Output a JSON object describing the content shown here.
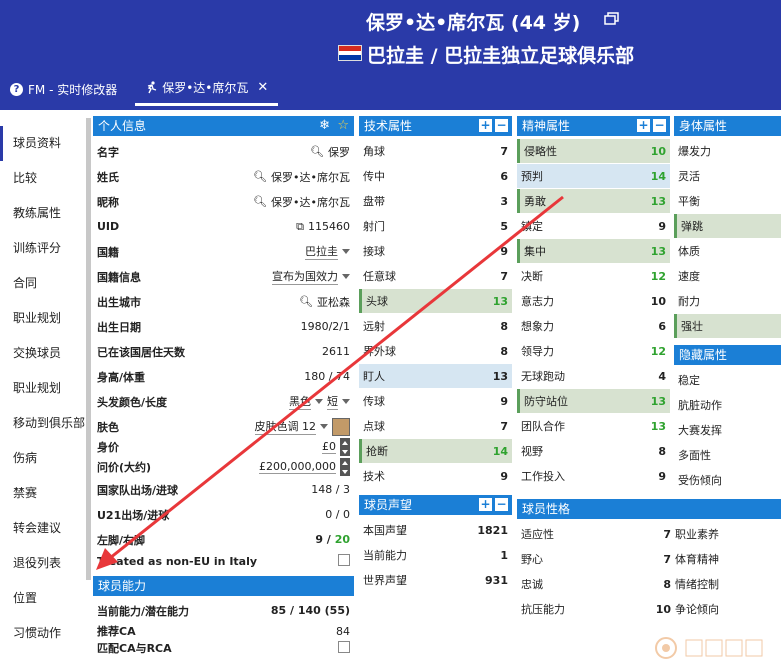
{
  "header": {
    "player_title": "保罗•达•席尔瓦 (44 岁)",
    "club": "巴拉圭 / 巴拉圭独立足球俱乐部",
    "flag_colors": [
      "#d52b1e",
      "#ffffff",
      "#0038a8"
    ],
    "background": "#2a3aa8"
  },
  "tabs": [
    {
      "label": "FM - 实时修改器",
      "icon": "question-icon"
    },
    {
      "label": "保罗•达•席尔瓦",
      "icon": "running-person-icon",
      "active": true
    }
  ],
  "sidebar": {
    "items": [
      "球员资料",
      "比较",
      "教练属性",
      "训练评分",
      "合同",
      "职业规划",
      "交换球员",
      "职业规划",
      "移动到俱乐部",
      "伤病",
      "禁赛",
      "转会建议",
      "退役列表",
      "位置",
      "习惯动作"
    ]
  },
  "personal": {
    "title": "个人信息",
    "rows": {
      "name": {
        "label": "名字",
        "value": "保罗"
      },
      "surname": {
        "label": "姓氏",
        "value": "保罗•达•席尔瓦"
      },
      "nickname": {
        "label": "昵称",
        "value": "保罗•达•席尔瓦"
      },
      "uid": {
        "label": "UID",
        "value": "115460"
      },
      "nationality": {
        "label": "国籍",
        "value": "巴拉圭"
      },
      "nation_info": {
        "label": "国籍信息",
        "value": "宣布为国效力"
      },
      "birth_city": {
        "label": "出生城市",
        "value": "亚松森"
      },
      "birth_date": {
        "label": "出生日期",
        "value": "1980/2/1"
      },
      "days_in_nation": {
        "label": "已在该国居住天数",
        "value": "2611"
      },
      "height_weight": {
        "label": "身高/体重",
        "value": "180 / 74"
      },
      "hair": {
        "label": "头发颜色/长度",
        "value": "黑色",
        "value2": "短"
      },
      "skin": {
        "label": "肤色",
        "value": "皮肤色调 12"
      },
      "worth": {
        "label": "身价",
        "value": "£0"
      },
      "asking": {
        "label": "问价(大约)",
        "value": "£200,000,000"
      },
      "caps": {
        "label": "国家队出场/进球",
        "value": "148 / 3"
      },
      "u21": {
        "label": "U21出场/进球",
        "value": "0 / 0"
      },
      "foot": {
        "label": "左脚/右脚",
        "value_left": "9 /",
        "value_right": "20"
      },
      "non_eu": {
        "label": "Treated as non-EU in Italy"
      }
    }
  },
  "ability": {
    "title": "球员能力",
    "rows": {
      "ca_pa": {
        "label": "当前能力/潜在能力",
        "value": "85 / 140 (55)"
      },
      "rec_ca": {
        "label": "推荐CA",
        "value": "84"
      },
      "match_ca": {
        "label": "匹配CA与RCA"
      }
    }
  },
  "technical": {
    "title": "技术属性",
    "items": [
      {
        "label": "角球",
        "value": "7"
      },
      {
        "label": "传中",
        "value": "6"
      },
      {
        "label": "盘带",
        "value": "3"
      },
      {
        "label": "射门",
        "value": "5"
      },
      {
        "label": "接球",
        "value": "9"
      },
      {
        "label": "任意球",
        "value": "7"
      },
      {
        "label": "头球",
        "value": "13",
        "hl": "green"
      },
      {
        "label": "远射",
        "value": "8"
      },
      {
        "label": "界外球",
        "value": "8"
      },
      {
        "label": "盯人",
        "value": "13",
        "hl": "blue"
      },
      {
        "label": "传球",
        "value": "9"
      },
      {
        "label": "点球",
        "value": "7"
      },
      {
        "label": "抢断",
        "value": "14",
        "hl": "green"
      },
      {
        "label": "技术",
        "value": "9"
      }
    ]
  },
  "reputation": {
    "title": "球员声望",
    "items": [
      {
        "label": "本国声望",
        "value": "1821"
      },
      {
        "label": "当前能力",
        "value": "1"
      },
      {
        "label": "世界声望",
        "value": "931"
      }
    ]
  },
  "mental": {
    "title": "精神属性",
    "items": [
      {
        "label": "侵略性",
        "value": "10",
        "hl": "green"
      },
      {
        "label": "预判",
        "value": "14",
        "hl": "blue"
      },
      {
        "label": "勇敢",
        "value": "13",
        "hl": "green"
      },
      {
        "label": "镇定",
        "value": "9"
      },
      {
        "label": "集中",
        "value": "13",
        "hl": "green"
      },
      {
        "label": "决断",
        "value": "12"
      },
      {
        "label": "意志力",
        "value": "10"
      },
      {
        "label": "想象力",
        "value": "6"
      },
      {
        "label": "领导力",
        "value": "12"
      },
      {
        "label": "无球跑动",
        "value": "4"
      },
      {
        "label": "防守站位",
        "value": "13",
        "hl": "green"
      },
      {
        "label": "团队合作",
        "value": "13"
      },
      {
        "label": "视野",
        "value": "8"
      },
      {
        "label": "工作投入",
        "value": "9"
      }
    ]
  },
  "physical": {
    "title": "身体属性",
    "items": [
      {
        "label": "爆发力"
      },
      {
        "label": "灵活"
      },
      {
        "label": "平衡"
      },
      {
        "label": "弹跳",
        "hl": "green"
      },
      {
        "label": "体质"
      },
      {
        "label": "速度"
      },
      {
        "label": "耐力"
      },
      {
        "label": "强壮",
        "hl": "green"
      }
    ]
  },
  "hidden": {
    "title": "隐藏属性",
    "items": [
      {
        "label": "稳定"
      },
      {
        "label": "肮脏动作"
      },
      {
        "label": "大赛发挥"
      },
      {
        "label": "多面性"
      },
      {
        "label": "受伤倾向"
      }
    ]
  },
  "personality": {
    "title": "球员性格",
    "items": [
      {
        "label": "适应性",
        "value": "7",
        "label2": "职业素养"
      },
      {
        "label": "野心",
        "value": "7",
        "label2": "体育精神"
      },
      {
        "label": "忠诚",
        "value": "8",
        "label2": "情绪控制"
      },
      {
        "label": "抗压能力",
        "value": "10",
        "label2": "争论倾向"
      }
    ]
  },
  "colors": {
    "panel_header": "#1b7fd6",
    "highlight_green": "#d7e2d0",
    "highlight_blue": "#d6e6f2",
    "arrow": "#e8373a"
  }
}
